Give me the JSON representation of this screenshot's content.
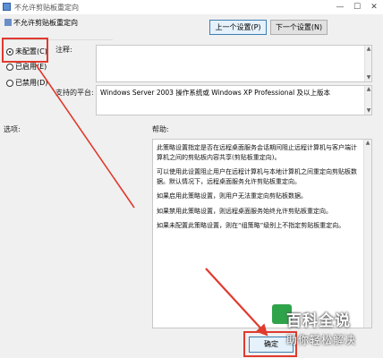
{
  "window": {
    "title": "不允许剪贴板重定向",
    "controls": {
      "minimize": "—",
      "maximize": "☐",
      "close": "✕"
    }
  },
  "header": {
    "policy_name": "不允许剪贴板重定向"
  },
  "nav": {
    "prev_label": "上一个设置(P)",
    "next_label": "下一个设置(N)"
  },
  "radios": [
    {
      "label": "未配置(C)",
      "selected": true
    },
    {
      "label": "已启用(E)",
      "selected": false
    },
    {
      "label": "已禁用(D)",
      "selected": false
    }
  ],
  "comment": {
    "label": "注释:",
    "value": ""
  },
  "supported": {
    "label": "支持的平台:",
    "value": "Windows Server 2003 操作系统或 Windows XP Professional 及以上版本"
  },
  "options": {
    "label": "选项:"
  },
  "help": {
    "label": "帮助:",
    "paragraphs": [
      "此策略设置指定是否在远程桌面服务会话期间阻止远程计算机与客户端计算机之间的剪贴板内容共享(剪贴板重定向)。",
      "可以使用此设置阻止用户在远程计算机与本地计算机之间重定向剪贴板数据。默认情况下，远程桌面服务允许剪贴板重定向。",
      "如果启用此策略设置，则用户无法重定向剪贴板数据。",
      "如果禁用此策略设置，则远程桌面服务始终允许剪贴板重定向。",
      "如果未配置此策略设置，则在“组策略”级别上不指定剪贴板重定向。"
    ]
  },
  "footer": {
    "ok_label": "确定"
  },
  "watermark": {
    "main": "百科全说",
    "sub": "助你轻松解决"
  },
  "colors": {
    "highlight_red": "#e03a2e",
    "accent_blue": "#3c7fb1"
  }
}
